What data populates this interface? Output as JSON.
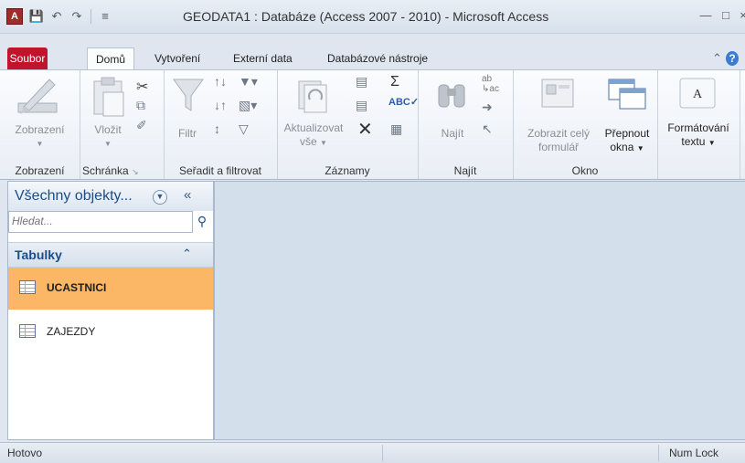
{
  "window": {
    "title": "GEODATA1 : Databáze (Access 2007 - 2010)  -  Microsoft Access",
    "app_icon_letter": "A",
    "qat_icons": [
      "save-icon",
      "undo-icon",
      "redo-icon",
      "customize-qat-icon"
    ],
    "controls": [
      "minimize-icon",
      "maximize-icon"
    ]
  },
  "tabs": [
    {
      "label": "Soubor"
    },
    {
      "label": "Domů",
      "active": true
    },
    {
      "label": "Vytvoření"
    },
    {
      "label": "Externí data"
    },
    {
      "label": "Databázové nástroje"
    }
  ],
  "ribbon": {
    "groups": [
      {
        "label": "Zobrazení",
        "buttons": [
          {
            "label": "Zobrazení"
          }
        ]
      },
      {
        "label": "Schránka",
        "buttons": [
          {
            "label": "Vložit"
          }
        ]
      },
      {
        "label": "Seřadit a filtrovat",
        "buttons": [
          {
            "label": "Filtr"
          }
        ]
      },
      {
        "label": "Záznamy",
        "buttons": [
          {
            "label": "Aktualizovat",
            "label2": "vše"
          }
        ]
      },
      {
        "label": "Najít",
        "buttons": [
          {
            "label": "Najít"
          }
        ]
      },
      {
        "label": "Okno",
        "buttons": [
          {
            "label": "Zobrazit celý",
            "label2": "formulář"
          },
          {
            "label": "Přepnout",
            "label2": "okna"
          }
        ]
      },
      {
        "label": "",
        "buttons": [
          {
            "label": "Formátování",
            "label2": "textu"
          }
        ]
      }
    ],
    "help_icon": "help-icon",
    "collapse_icon": "collapse-ribbon-icon"
  },
  "navpane": {
    "title": "Všechny objekty...",
    "search_placeholder": "Hledat...",
    "group_title": "Tabulky",
    "items": [
      {
        "label": "UCASTNICI",
        "selected": true
      },
      {
        "label": "ZAJEZDY",
        "selected": false
      }
    ]
  },
  "status": {
    "left": "Hotovo",
    "right": "Num Lock"
  },
  "colors": {
    "soubor_tab": "#c0142d",
    "selected_item": "#fbb766",
    "nav_title": "#1b4d89",
    "workspace": "#d4dfec"
  }
}
